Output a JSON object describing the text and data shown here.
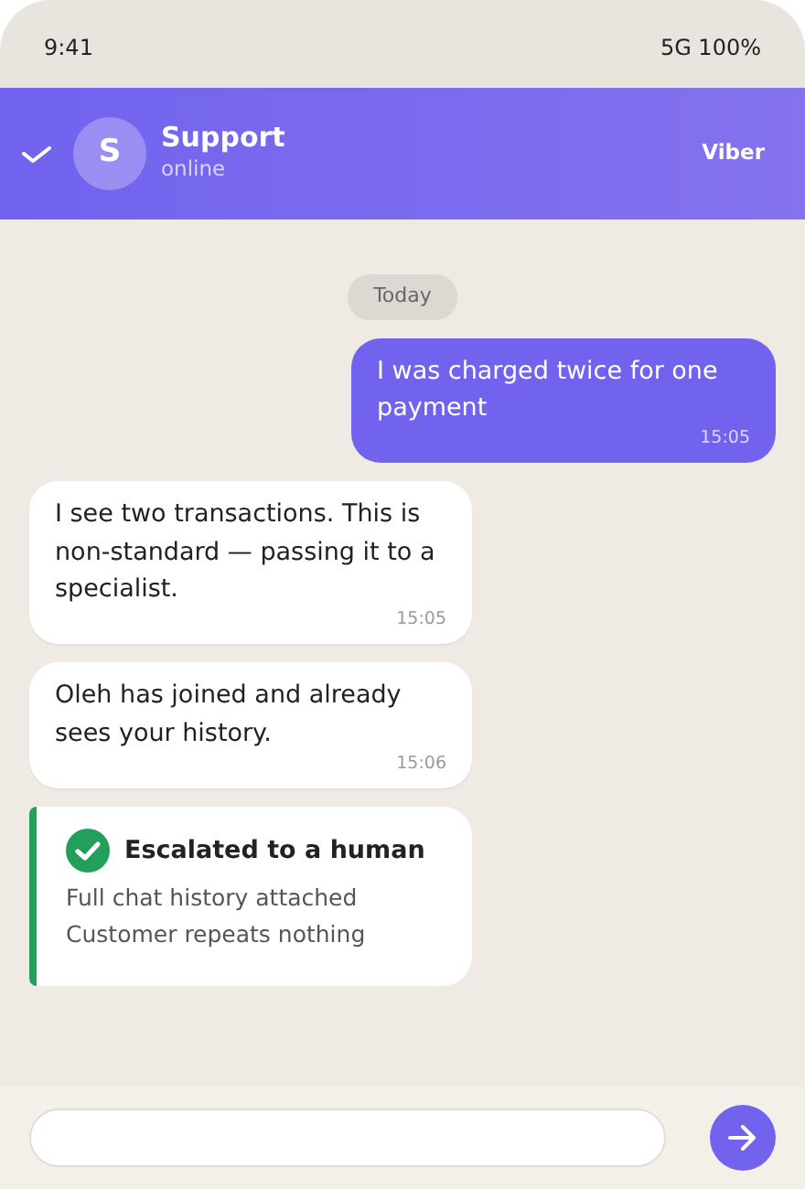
{
  "status_bar": {
    "time": "9:41",
    "network": "5G 100%"
  },
  "header": {
    "avatar_letter": "S",
    "name": "Support",
    "status": "online",
    "app": "Viber"
  },
  "date_divider": "Today",
  "messages": [
    {
      "kind": "outgoing",
      "text": "I was charged twice for one payment",
      "time": "15:05"
    },
    {
      "kind": "incoming",
      "text": "I see two transactions. This is non-standard — passing it to a specialist.",
      "time": "15:05"
    },
    {
      "kind": "incoming",
      "text": "Oleh has joined and already sees your history.",
      "time": "15:06"
    },
    {
      "kind": "system",
      "title": "Escalated to a human",
      "lines": [
        "Full chat history attached",
        "Customer repeats nothing"
      ]
    }
  ]
}
